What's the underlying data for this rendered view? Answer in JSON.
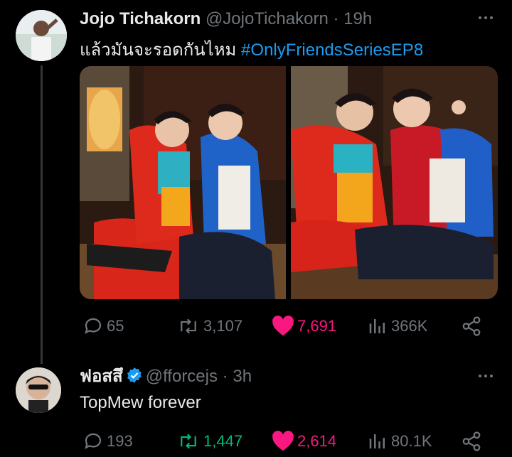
{
  "tweet": {
    "name": "Jojo Tichakorn",
    "handle": "@JojoTichakorn",
    "time": "19h",
    "text": "แล้วมันจะรอดกันไหม",
    "hashtag": "#OnlyFriendsSeriesEP8",
    "stats": {
      "replies": "65",
      "reposts": "3,107",
      "likes": "7,691",
      "views": "366K"
    }
  },
  "reply": {
    "name": "ฟอสสึ",
    "handle": "@fforcejs",
    "time": "3h",
    "text": "TopMew forever",
    "stats": {
      "replies": "193",
      "reposts": "1,447",
      "likes": "2,614",
      "views": "80.1K"
    }
  },
  "colors": {
    "background": "#000000",
    "like": "#f91880",
    "repost_active": "#00ba7c",
    "link": "#1d9bf0",
    "muted": "#71767b"
  }
}
